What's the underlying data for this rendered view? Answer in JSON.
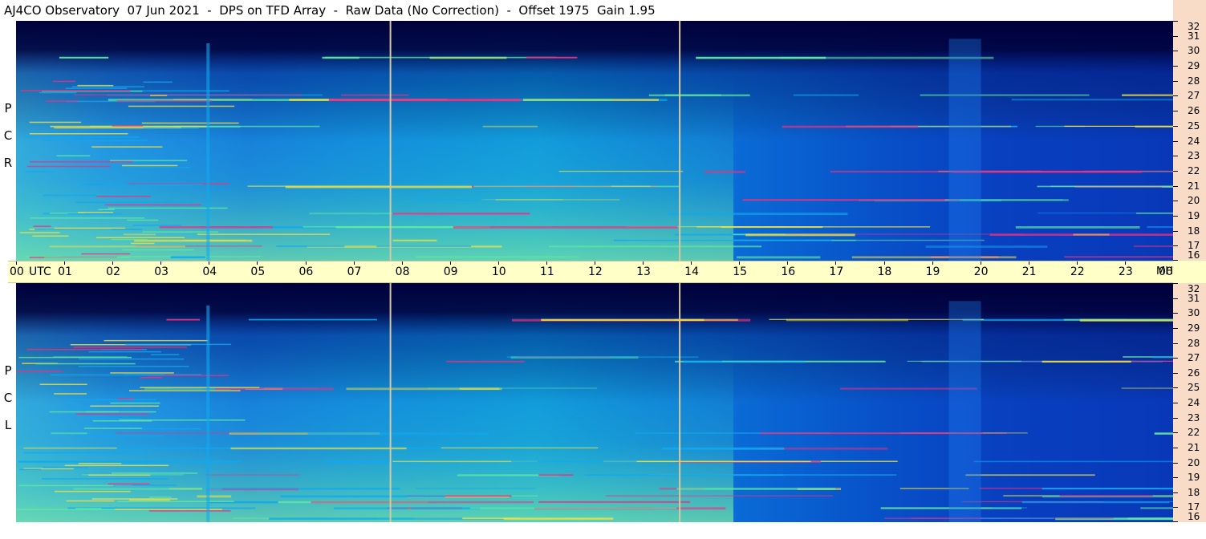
{
  "title": "AJ4CO Observatory  07 Jun 2021  -  DPS on TFD Array  -  Raw Data (No Correction)  -  Offset 1975  Gain 1.95",
  "chart_data": [
    {
      "type": "heatmap",
      "name": "RCP",
      "side_label": [
        "R",
        "C",
        "P"
      ],
      "x_label": "UTC",
      "y_label": "MHz",
      "x_ticks": [
        "00",
        "01",
        "02",
        "03",
        "04",
        "05",
        "06",
        "07",
        "08",
        "09",
        "10",
        "11",
        "12",
        "13",
        "14",
        "15",
        "16",
        "17",
        "18",
        "19",
        "20",
        "21",
        "22",
        "23",
        "00"
      ],
      "y_ticks": [
        16,
        17,
        18,
        19,
        20,
        21,
        22,
        23,
        24,
        25,
        26,
        27,
        28,
        29,
        30,
        31,
        32
      ],
      "xlim_hours": [
        0,
        24
      ],
      "ylim_mhz": [
        16,
        32
      ],
      "marker_lines_utc_hours": [
        7.75,
        13.75
      ]
    },
    {
      "type": "heatmap",
      "name": "LCP",
      "side_label": [
        "L",
        "C",
        "P"
      ],
      "x_label": "UTC",
      "y_label": "MHz",
      "x_ticks": [
        "00",
        "01",
        "02",
        "03",
        "04",
        "05",
        "06",
        "07",
        "08",
        "09",
        "10",
        "11",
        "12",
        "13",
        "14",
        "15",
        "16",
        "17",
        "18",
        "19",
        "20",
        "21",
        "22",
        "23",
        "00"
      ],
      "y_ticks": [
        16,
        17,
        18,
        19,
        20,
        21,
        22,
        23,
        24,
        25,
        26,
        27,
        28,
        29,
        30,
        31,
        32
      ],
      "xlim_hours": [
        0,
        24
      ],
      "ylim_mhz": [
        16,
        32
      ],
      "marker_lines_utc_hours": [
        7.75,
        13.75
      ]
    }
  ],
  "colors": {
    "background_deep": "#00003a",
    "spectrum_low": "#1030d0",
    "spectrum_mid": "#10a8f0",
    "spectrum_high": "#60e8a0",
    "spectrum_hot": "#f0e040",
    "spectrum_peak": "#f03080",
    "time_axis_bg": "#ffffc8",
    "freq_axis_bg": "#f8dcc8",
    "marker_line": "#d8c8a0"
  }
}
